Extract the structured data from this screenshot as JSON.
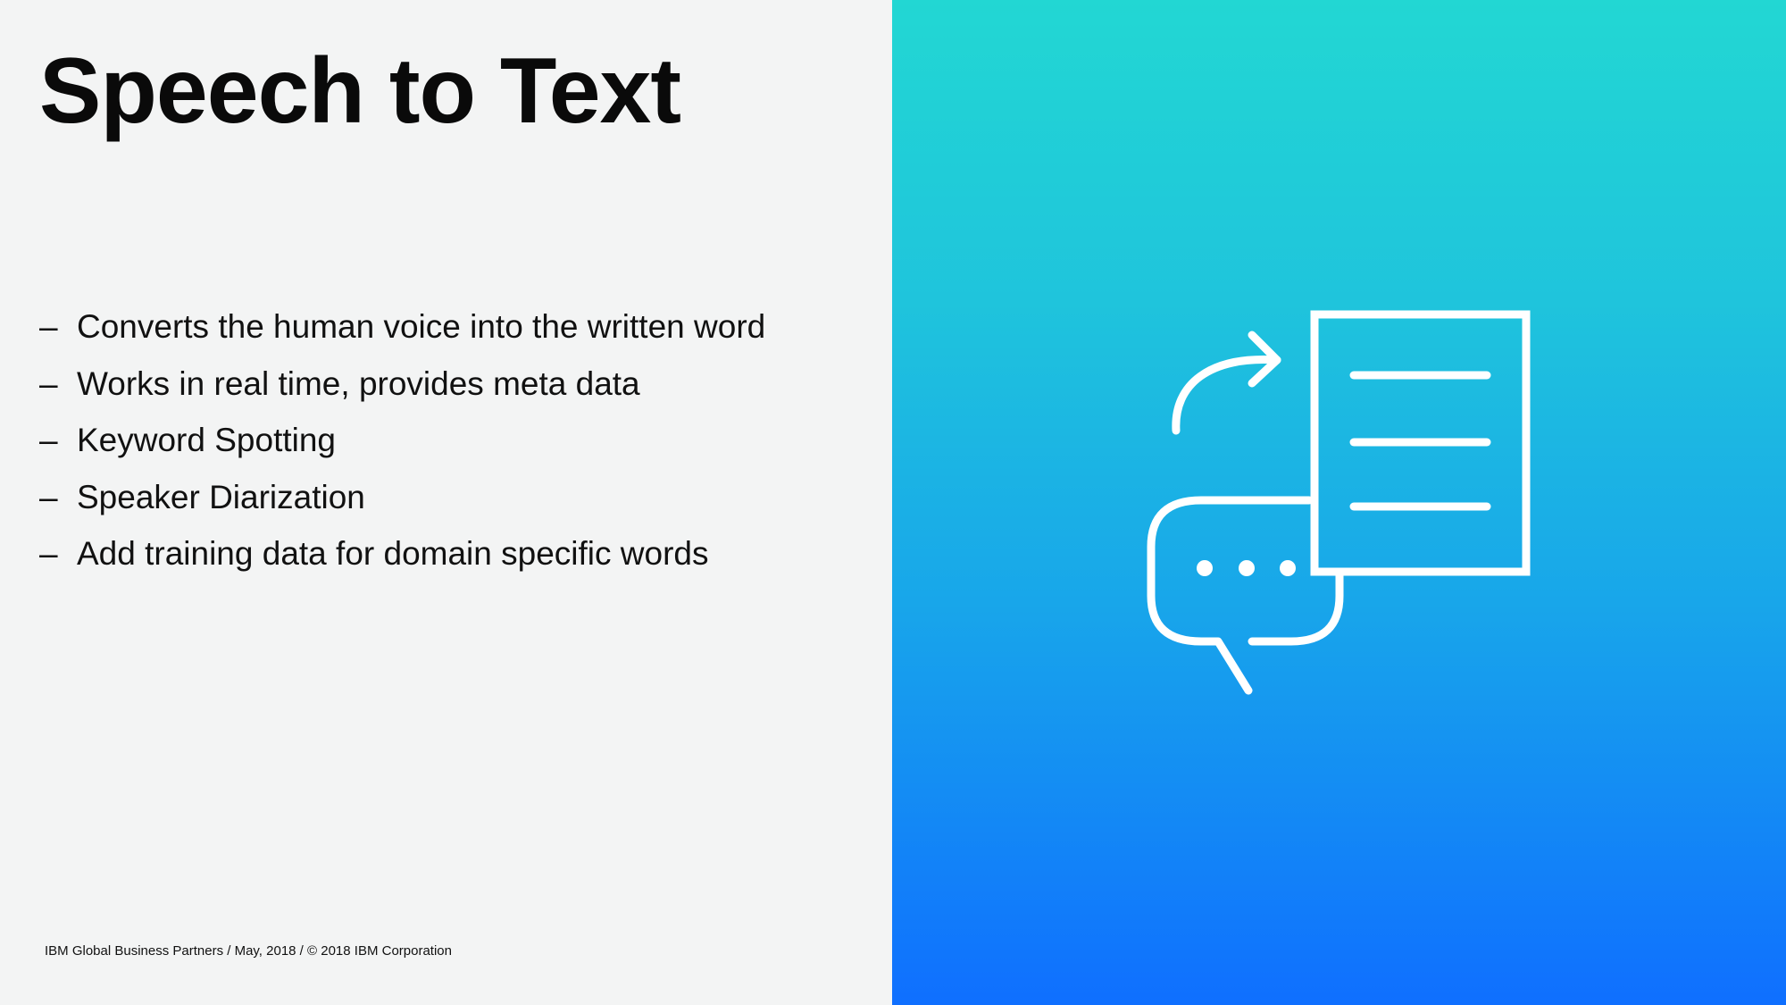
{
  "slide": {
    "title": "Speech to Text",
    "bullets": [
      "Converts the human voice into the written word",
      "Works in real time, provides meta data",
      "Keyword Spotting",
      "Speaker Diarization",
      "Add training data for domain specific words"
    ],
    "bullet_marker": "–",
    "footer": "IBM Global Business Partners / May, 2018 / © 2018 IBM Corporation"
  },
  "illustration": {
    "icons": [
      "curved-arrow-icon",
      "document-icon",
      "chat-bubble-icon"
    ],
    "stroke_color": "#ffffff"
  },
  "colors": {
    "left_background": "#f3f4f4",
    "gradient_top": "#22d7d3",
    "gradient_bottom": "#0f6fff",
    "text": "#0a0a0a"
  }
}
